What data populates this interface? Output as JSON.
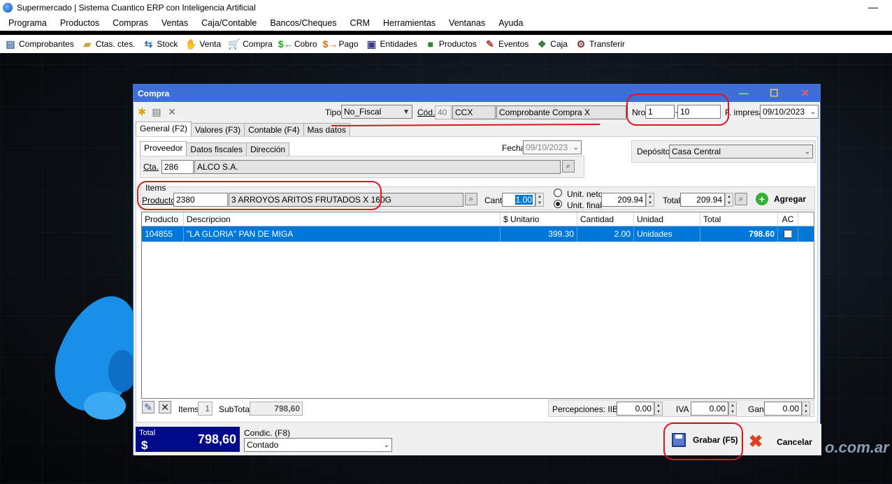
{
  "app": {
    "title": "Supermercado | Sistema Cuantico ERP con Inteligencia Artificial",
    "minimize": "—"
  },
  "menu": [
    "Programa",
    "Productos",
    "Compras",
    "Ventas",
    "Caja/Contable",
    "Bancos/Cheques",
    "CRM",
    "Herramientas",
    "Ventanas",
    "Ayuda"
  ],
  "toolbar": [
    {
      "label": "Comprobantes",
      "icon": "document-icon"
    },
    {
      "label": "Ctas. ctes.",
      "icon": "folder-icon"
    },
    {
      "label": "Stock",
      "icon": "stock-icon"
    },
    {
      "label": "Venta",
      "icon": "hand-icon"
    },
    {
      "label": "Compra",
      "icon": "cart-icon"
    },
    {
      "label": "Cobro",
      "icon": "dollar-in-icon"
    },
    {
      "label": "Pago",
      "icon": "dollar-out-icon"
    },
    {
      "label": "Entidades",
      "icon": "card-icon"
    },
    {
      "label": "Productos",
      "icon": "box-icon"
    },
    {
      "label": "Eventos",
      "icon": "notepad-icon"
    },
    {
      "label": "Caja",
      "icon": "money-icon"
    },
    {
      "label": "Transferir",
      "icon": "transfer-icon"
    }
  ],
  "background": {
    "watermark": "o.com.ar"
  },
  "window": {
    "title": "Compra",
    "header": {
      "tipo_label": "Tipo",
      "tipo_value": "No_Fiscal",
      "cod_label": "Cód.",
      "cod_num": "40",
      "cod_code": "CCX",
      "cod_desc": "Comprobante Compra X",
      "nro_label": "Nro",
      "nro_pv": "1",
      "nro_sep": "-",
      "nro_num": "10",
      "fimpresa_label": "F. impresa",
      "fimpresa_value": "09/10/2023"
    },
    "tabs": [
      "General (F2)",
      "Valores (F3)",
      "Contable (F4)",
      "Mas datos"
    ],
    "subtabs": [
      "Proveedor",
      "Datos fiscales",
      "Dirección"
    ],
    "fecha_label": "Fecha",
    "fecha_value": "09/10/2023",
    "deposito_label": "Depósito",
    "deposito_value": "Casa Central",
    "cta_label": "Cta.",
    "cta_num": "286",
    "cta_name": "ALCO S.A.",
    "items": {
      "group_label": "Items",
      "producto_label": "Producto",
      "producto_code": "2380",
      "producto_desc": "3 ARROYOS ARITOS FRUTADOS X 160G",
      "cant_label": "Cant.",
      "cant_value": "1.00",
      "unit_neto": "Unit. neto",
      "unit_final": "Unit. final",
      "unit_value": "209.94",
      "total_label": "Total",
      "total_value": "209.94",
      "agregar": "Agregar"
    },
    "grid": {
      "headers": [
        "Producto",
        "Descripcion",
        "$ Unitario",
        "Cantidad",
        "Unidad",
        "Total",
        "AC"
      ],
      "rows": [
        {
          "producto": "104855",
          "descripcion": "\"LA GLORIA\" PAN DE MIGA",
          "unitario": "399.30",
          "cantidad": "2.00",
          "unidad": "Unidades",
          "total": "798.60",
          "ac": false
        }
      ]
    },
    "footer": {
      "items_label": "Items",
      "items_count": "1",
      "subtotal_label": "SubTotal",
      "subtotal_value": "798,60",
      "perc_label": "Percepciones: IIBB",
      "perc_value": "0.00",
      "iva_label": "IVA",
      "iva_value": "0.00",
      "gan_label": "Gan.",
      "gan_value": "0.00"
    },
    "bottom": {
      "total_label": "Total",
      "total_symbol": "$",
      "total_value": "798,60",
      "condic_label": "Condic. (F8)",
      "condic_value": "Contado",
      "grabar": "Grabar (F5)",
      "cancelar": "Cancelar"
    }
  },
  "colors": {
    "accent": "#3d6fd6",
    "selection": "#0078d7",
    "total_bg": "#000a8a",
    "highlight": "#e0141e"
  }
}
